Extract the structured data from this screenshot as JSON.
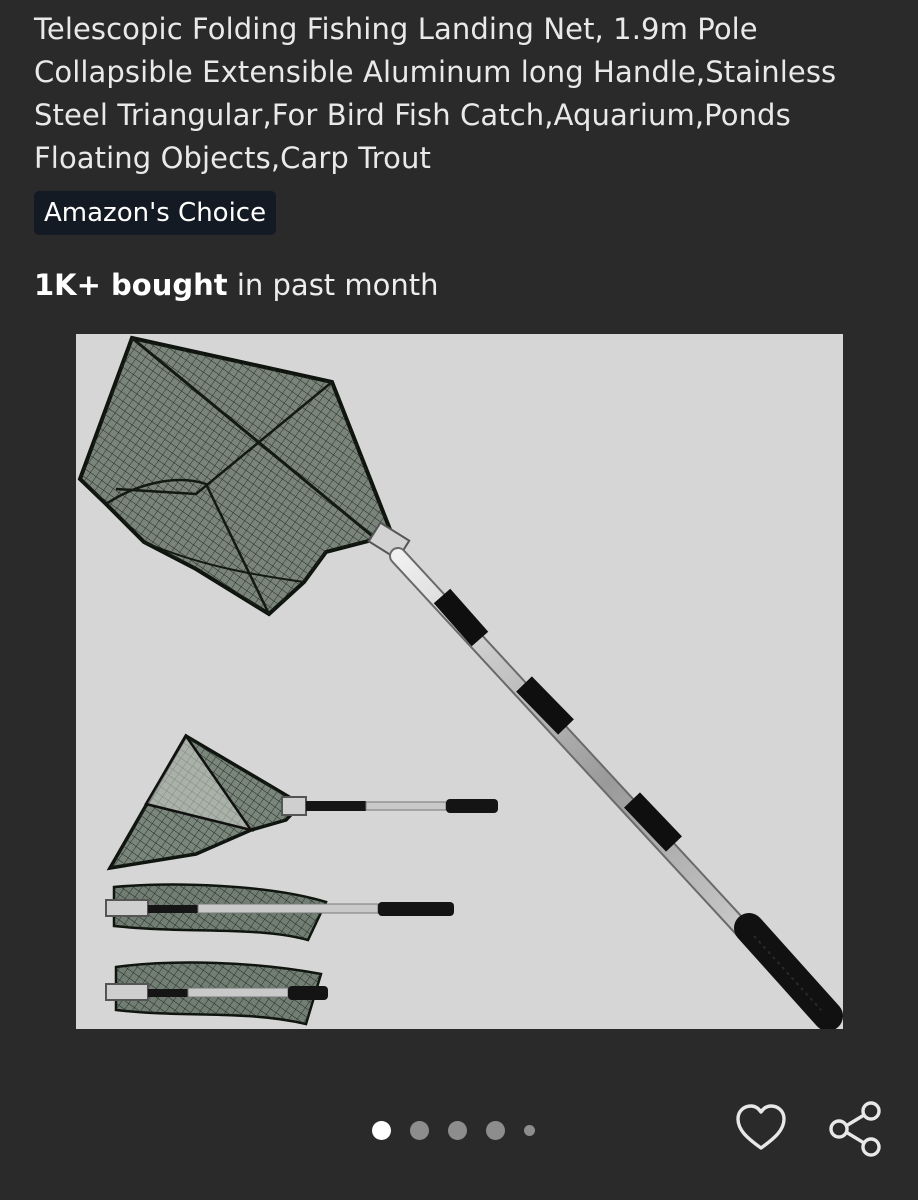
{
  "product": {
    "title": "Telescopic Folding Fishing Landing Net, 1.9m Pole Collapsible Extensible Aluminum long Handle,Stainless Steel Triangular,For Bird Fish Catch,Aquarium,Ponds Floating Objects,Carp Trout",
    "badge": "Amazon's Choice",
    "bought_count": "1K+ bought",
    "bought_suffix": "in past month"
  },
  "gallery": {
    "image_count": 5,
    "active_index": 0,
    "background_color": "#d6d6d6"
  },
  "actions": {
    "favorite_icon": "heart-icon",
    "share_icon": "share-icon"
  },
  "colors": {
    "page_background": "#2a2a2b",
    "badge_background": "#141a24",
    "text": "#e9e9e9"
  }
}
